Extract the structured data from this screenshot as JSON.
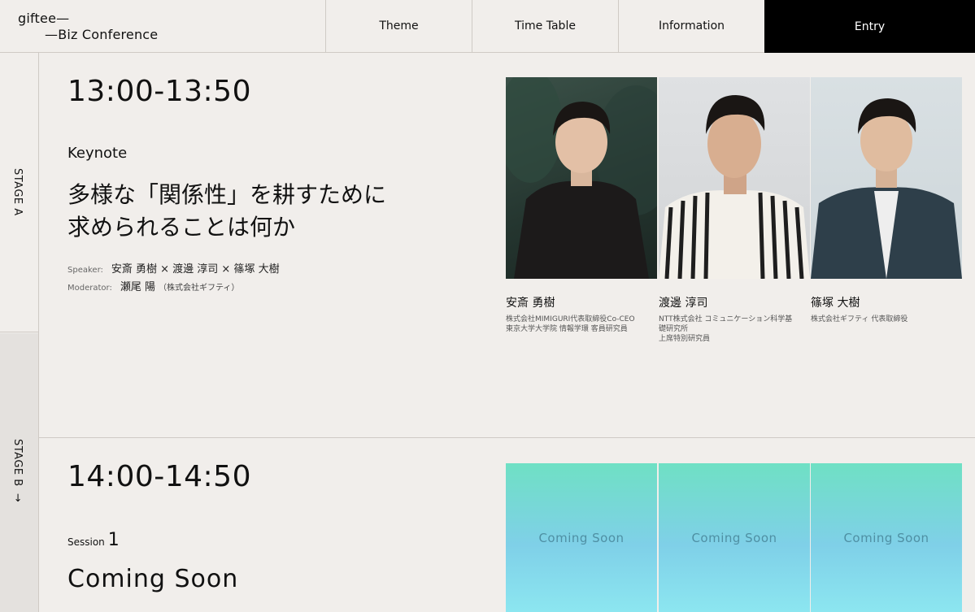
{
  "header": {
    "logo_line1": "giftee—",
    "logo_line2": "—Biz Conference",
    "nav": [
      "Theme",
      "Time Table",
      "Information"
    ],
    "entry": "Entry"
  },
  "sidebar": {
    "stage_a": "STAGE A",
    "stage_b": "STAGE B",
    "arrow": "→"
  },
  "session1": {
    "time": "13:00-13:50",
    "kind": "Keynote",
    "title_line1": "多様な「関係性」を耕すために",
    "title_line2": "求められることは何か",
    "speaker_label": "Speaker:",
    "speakers": "安斎 勇樹 × 渡邊 淳司 × 篠塚 大樹",
    "moderator_label": "Moderator:",
    "moderator": "瀬尾 陽",
    "moderator_aff": "（株式会社ギフティ）",
    "people": [
      {
        "name": "安斎 勇樹",
        "desc1": "株式会社MIMIGURI代表取締役Co-CEO",
        "desc2": "東京大学大学院 情報学環 客員研究員",
        "desc3": ""
      },
      {
        "name": "渡邊 淳司",
        "desc1": "NTT株式会社 コミュニケーション科学基",
        "desc2": "礎研究所",
        "desc3": "上席特別研究員"
      },
      {
        "name": "篠塚 大樹",
        "desc1": "株式会社ギフティ 代表取締役",
        "desc2": "",
        "desc3": ""
      }
    ]
  },
  "session2": {
    "time": "14:00-14:50",
    "kind": "Session",
    "kind_num": "1",
    "title": "Coming Soon",
    "placeholder": "Coming Soon"
  }
}
